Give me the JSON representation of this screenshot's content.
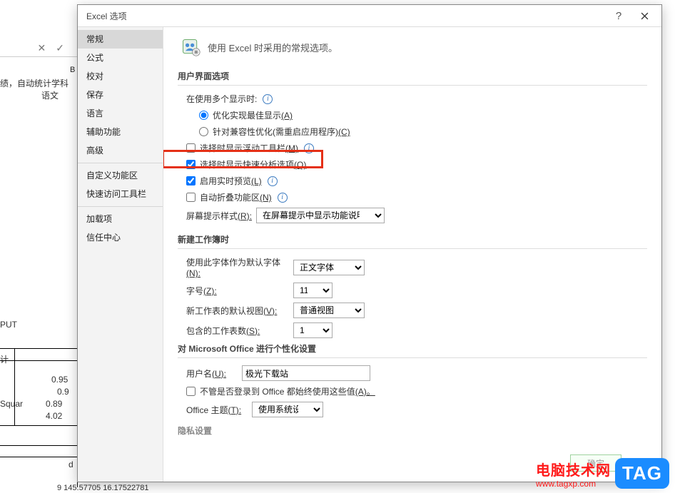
{
  "bg": {
    "colB": "B",
    "txt1": "绩，自动统计学科",
    "txt2": "语文",
    "put": "PUT",
    "ji": "计",
    "n1": "0.95",
    "n2": "0.9",
    "sq": "Squar",
    "n3": "0.89",
    "n4": "4.02",
    "d": "d",
    "bot": "9  145.57705   16.17522781",
    "x": "✕",
    "check": "✓"
  },
  "dialog": {
    "title": "Excel 选项",
    "help": "?",
    "heading": "使用 Excel 时采用的常规选项。"
  },
  "sidebar": {
    "items": [
      "常规",
      "公式",
      "校对",
      "保存",
      "语言",
      "辅助功能",
      "高级",
      "自定义功能区",
      "快速访问工具栏",
      "加载项",
      "信任中心"
    ]
  },
  "sections": {
    "ui_options": "用户界面选项",
    "new_workbook": "新建工作簿时",
    "personalize": "对 Microsoft Office 进行个性化设置",
    "privacy": "隐私设置"
  },
  "ui": {
    "multi_display": "在使用多个显示时:",
    "opt_best_label": "优化实现最佳显示",
    "opt_best_accel": "(A)",
    "opt_compat_label": "针对兼容性优化(需重启应用程序)",
    "opt_compat_accel": "(C)",
    "mini_toolbar_label": "选择时显示浮动工具栏",
    "mini_toolbar_accel": "(M)",
    "quick_analysis_label": "选择时显示快速分析选项",
    "quick_analysis_accel": "(Q)",
    "live_preview_label": "启用实时预览",
    "live_preview_accel": "(L)",
    "collapse_ribbon_label": "自动折叠功能区",
    "collapse_ribbon_accel": "(N)",
    "screentip_label_a": "屏幕提示样式",
    "screentip_label_b": "(R):",
    "screentip_value": "在屏幕提示中显示功能说明"
  },
  "wb": {
    "font_label_a": "使用此字体作为默认字体",
    "font_label_b": "(N):",
    "font_value": "正文字体",
    "size_label_a": "字号",
    "size_label_b": "(Z):",
    "size_value": "11",
    "view_label_a": "新工作表的默认视图",
    "view_label_b": "(V):",
    "view_value": "普通视图",
    "sheets_label_a": "包含的工作表数",
    "sheets_label_b": "(S):",
    "sheets_value": "1"
  },
  "pers": {
    "user_label_a": "用户名",
    "user_label_b": "(U):",
    "user_value": "极光下载站",
    "always_label": "不管是否登录到 Office 都始终使用这些值",
    "always_accel": "(A)。",
    "theme_label_a": "Office 主题",
    "theme_label_b": "(T):",
    "theme_value": "使用系统设置"
  },
  "info_glyph": "i",
  "ok_button": "确定",
  "watermark": {
    "text": "电脑技术网",
    "url": "www.tagxp.com",
    "tag": "TAG"
  }
}
